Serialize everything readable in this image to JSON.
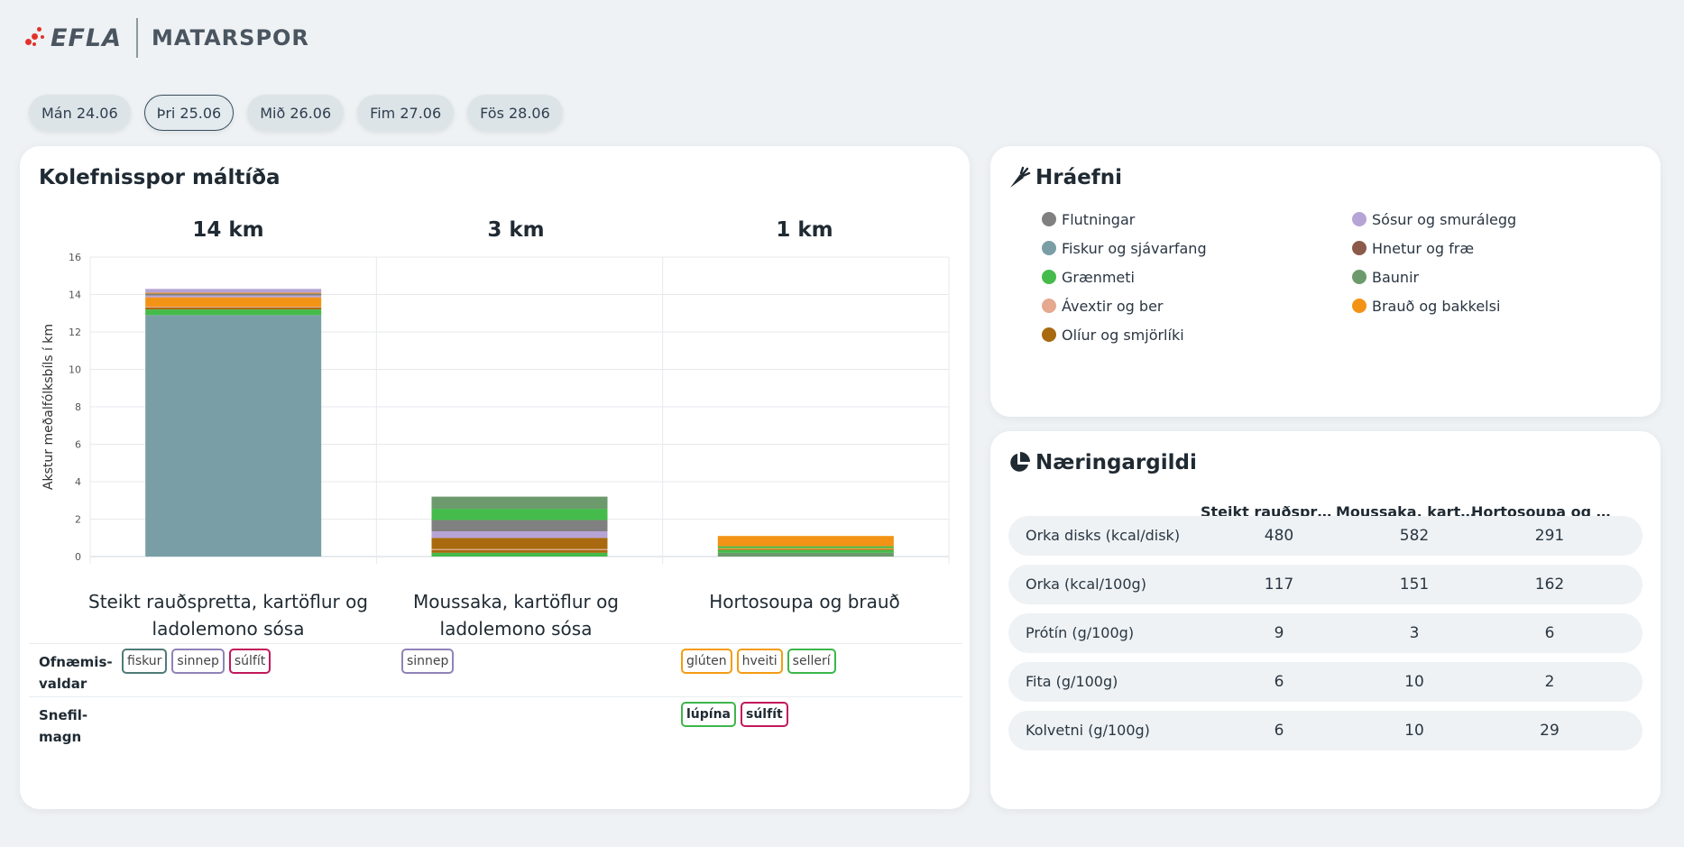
{
  "header": {
    "logo_text": "EFLA",
    "app_title": "MATARSPOR"
  },
  "tabs": [
    {
      "label": "Mán 24.06",
      "active": false
    },
    {
      "label": "Þri 25.06",
      "active": true
    },
    {
      "label": "Mið 26.06",
      "active": false
    },
    {
      "label": "Fim 27.06",
      "active": false
    },
    {
      "label": "Fös 28.06",
      "active": false
    }
  ],
  "carbon_card": {
    "title": "Kolefnisspor máltíða",
    "allergens_label": "Ofnæmis-valdar",
    "trace_label": "Snefil-magn"
  },
  "meals": [
    {
      "name": "Steikt rauðspretta, kartöflur og ladolemono sósa",
      "km_label": "14 km",
      "allergens": [
        {
          "text": "fiskur",
          "color": "#4e7b77"
        },
        {
          "text": "sinnep",
          "color": "#8f83b8"
        },
        {
          "text": "súlfít",
          "color": "#c2185b"
        }
      ],
      "traces": []
    },
    {
      "name": "Moussaka, kartöflur og ladolemono sósa",
      "km_label": "3 km",
      "allergens": [
        {
          "text": "sinnep",
          "color": "#8f83b8"
        }
      ],
      "traces": []
    },
    {
      "name": "Hortosoupa og brauð",
      "km_label": "1 km",
      "allergens": [
        {
          "text": "glúten",
          "color": "#f39c12"
        },
        {
          "text": "hveiti",
          "color": "#f39c12"
        },
        {
          "text": "sellerí",
          "color": "#3db64a"
        }
      ],
      "traces": [
        {
          "text": "lúpína",
          "color": "#3db64a"
        },
        {
          "text": "súlfít",
          "color": "#c2185b"
        }
      ]
    }
  ],
  "chart_data": {
    "type": "bar",
    "stacked": true,
    "ylabel": "Akstur meðalfólksbíls í km",
    "ylim": [
      0,
      16
    ],
    "yticks": [
      0,
      2,
      4,
      6,
      8,
      10,
      12,
      14,
      16
    ],
    "categories": [
      "Steikt rauðspretta, kartöflur og ladolemono sósa",
      "Moussaka, kartöflur og ladolemono sósa",
      "Hortosoupa og brauð"
    ],
    "grid": true,
    "series": [
      {
        "name": "Fiskur og sjávarfang",
        "color": "#7a9ea6",
        "values": [
          12.9,
          0,
          0
        ]
      },
      {
        "name": "Baunir",
        "color": "#6c9a6c",
        "values": [
          0,
          0,
          0.2
        ]
      },
      {
        "name": "Grænmeti",
        "color": "#44bb4a",
        "values": [
          0.3,
          0.2,
          0.15
        ]
      },
      {
        "name": "Olíur og smjörlíki",
        "color": "#a8690f",
        "values": [
          0.1,
          0.15,
          0.05
        ]
      },
      {
        "name": "Ávextir og ber",
        "color": "#e4a98f",
        "values": [
          0.05,
          0.05,
          0
        ]
      },
      {
        "name": "Brauð og bakkelsi",
        "color": "#f39316",
        "values": [
          0.5,
          0,
          0.05
        ]
      },
      {
        "name": "Olíur og smjörlíki",
        "color": "#a8690f",
        "values": [
          0,
          0.6,
          0
        ]
      },
      {
        "name": "Sósur og smurálegg",
        "color": "#b7a4d6",
        "values": [
          0.1,
          0.35,
          0
        ]
      },
      {
        "name": "Flutningar",
        "color": "#808080",
        "values": [
          0.1,
          0.6,
          0
        ]
      },
      {
        "name": "Grænmeti",
        "color": "#44bb4a",
        "values": [
          0,
          0.6,
          0.1
        ]
      },
      {
        "name": "Baunir",
        "color": "#6c9a6c",
        "values": [
          0,
          0.65,
          0
        ]
      },
      {
        "name": "Brauð og bakkelsi",
        "color": "#f39316",
        "values": [
          0.05,
          0,
          0.55
        ]
      },
      {
        "name": "Sósur og smurálegg",
        "color": "#b7a4d6",
        "values": [
          0.2,
          0,
          0
        ]
      }
    ]
  },
  "ingredients_card": {
    "title": "Hráefni",
    "legend": [
      {
        "label": "Flutningar",
        "color": "#808080"
      },
      {
        "label": "Sósur og smurálegg",
        "color": "#b7a4d6"
      },
      {
        "label": "Fiskur og sjávarfang",
        "color": "#7a9ea6"
      },
      {
        "label": "Hnetur og fræ",
        "color": "#8c5a4a"
      },
      {
        "label": "Grænmeti",
        "color": "#44bb4a"
      },
      {
        "label": "Baunir",
        "color": "#6c9a6c"
      },
      {
        "label": "Ávextir og ber",
        "color": "#e4a98f"
      },
      {
        "label": "Brauð og bakkelsi",
        "color": "#f39316"
      },
      {
        "label": "Olíur og smjörlíki",
        "color": "#a8690f"
      }
    ]
  },
  "nutrition_card": {
    "title": "Næringargildi",
    "columns": [
      "Steikt rauðspretta,...",
      "Moussaka, kartöfl...",
      "Hortosoupa og bra..."
    ],
    "rows": [
      {
        "label": "Orka disks (kcal/disk)",
        "values": [
          "480",
          "582",
          "291"
        ]
      },
      {
        "label": "Orka (kcal/100g)",
        "values": [
          "117",
          "151",
          "162"
        ]
      },
      {
        "label": "Prótín (g/100g)",
        "values": [
          "9",
          "3",
          "6"
        ]
      },
      {
        "label": "Fita (g/100g)",
        "values": [
          "6",
          "10",
          "2"
        ]
      },
      {
        "label": "Kolvetni (g/100g)",
        "values": [
          "6",
          "10",
          "29"
        ]
      }
    ]
  }
}
